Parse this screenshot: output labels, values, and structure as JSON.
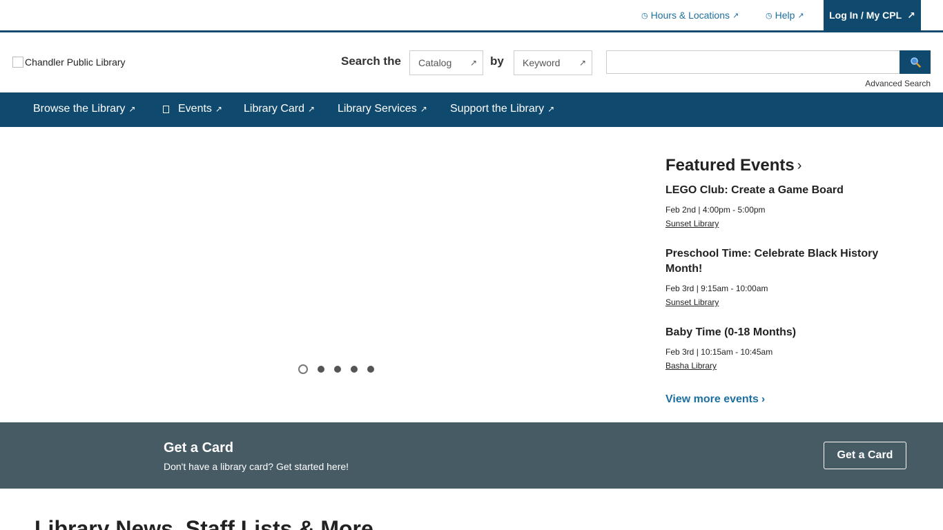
{
  "utility": {
    "hours_label": "Hours & Locations",
    "help_label": "Help",
    "login_label": "Log In / My CPL"
  },
  "header": {
    "logo_alt": "Chandler Public Library",
    "search_the_label": "Search the",
    "catalog_select": "Catalog",
    "by_label": "by",
    "keyword_select": "Keyword",
    "search_input_value": "",
    "advanced_search_label": "Advanced Search"
  },
  "nav": {
    "items": [
      {
        "label": "Browse the Library"
      },
      {
        "label": "Events"
      },
      {
        "label": "Library Card"
      },
      {
        "label": "Library Services"
      },
      {
        "label": "Support the Library"
      }
    ]
  },
  "carousel": {
    "slide_count": 5,
    "active_index": 0
  },
  "featured": {
    "title": "Featured Events",
    "events": [
      {
        "title": "LEGO Club: Create a Game Board",
        "date": "Feb 2nd | 4:00pm - 5:00pm",
        "location": "Sunset Library"
      },
      {
        "title": "Preschool Time: Celebrate Black History Month!",
        "date": "Feb 3rd | 9:15am - 10:00am",
        "location": "Sunset Library"
      },
      {
        "title": "Baby Time (0-18 Months)",
        "date": "Feb 3rd | 10:15am - 10:45am",
        "location": "Basha Library"
      }
    ],
    "view_more_label": "View more events"
  },
  "card_banner": {
    "title": "Get a Card",
    "subtitle": "Don't have a library card? Get started here!",
    "button_label": "Get a Card"
  },
  "news": {
    "heading": "Library News, Staff Lists & More"
  },
  "colors": {
    "brand_navy": "#0f4a6e",
    "link_blue": "#1d6fa0",
    "banner_slate": "#475b65"
  }
}
